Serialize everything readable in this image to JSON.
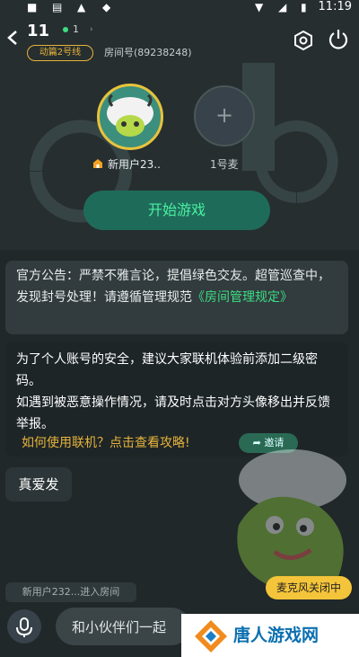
{
  "status_bar": {
    "time": "11:19"
  },
  "header": {
    "room_title": "11",
    "online_count": "1",
    "level_badge": "动篇2号线",
    "room_id": "房间号(89238248)"
  },
  "seats": [
    {
      "name": "新用户23..",
      "role": "host"
    },
    {
      "label": "1号麦"
    }
  ],
  "start_button": "开始游戏",
  "notice": {
    "text": "官方公告：严禁不雅言论，提倡绿色交友。超管巡查中，发现封号处理！请遵循管理规范",
    "link": "《房间管理规定》"
  },
  "tips": {
    "line1": "为了个人账号的安全，建议大家联机体验前添加二级密码。",
    "line2": "如遇到被恶意操作情况，请及时点击对方头像移出并反馈举报。",
    "link": "如何使用联机？点击查看攻略!",
    "invite": "邀请"
  },
  "message": "真爱发",
  "join_notice": "新用户232...进入房间",
  "mic_status": "麦克风关闭中",
  "input": {
    "placeholder": "和小伙伴们一起"
  },
  "watermark": {
    "text": "唐人游戏网"
  },
  "colors": {
    "accent_green": "#3ddc84",
    "gold": "#e7b33a",
    "background": "#262e30"
  }
}
